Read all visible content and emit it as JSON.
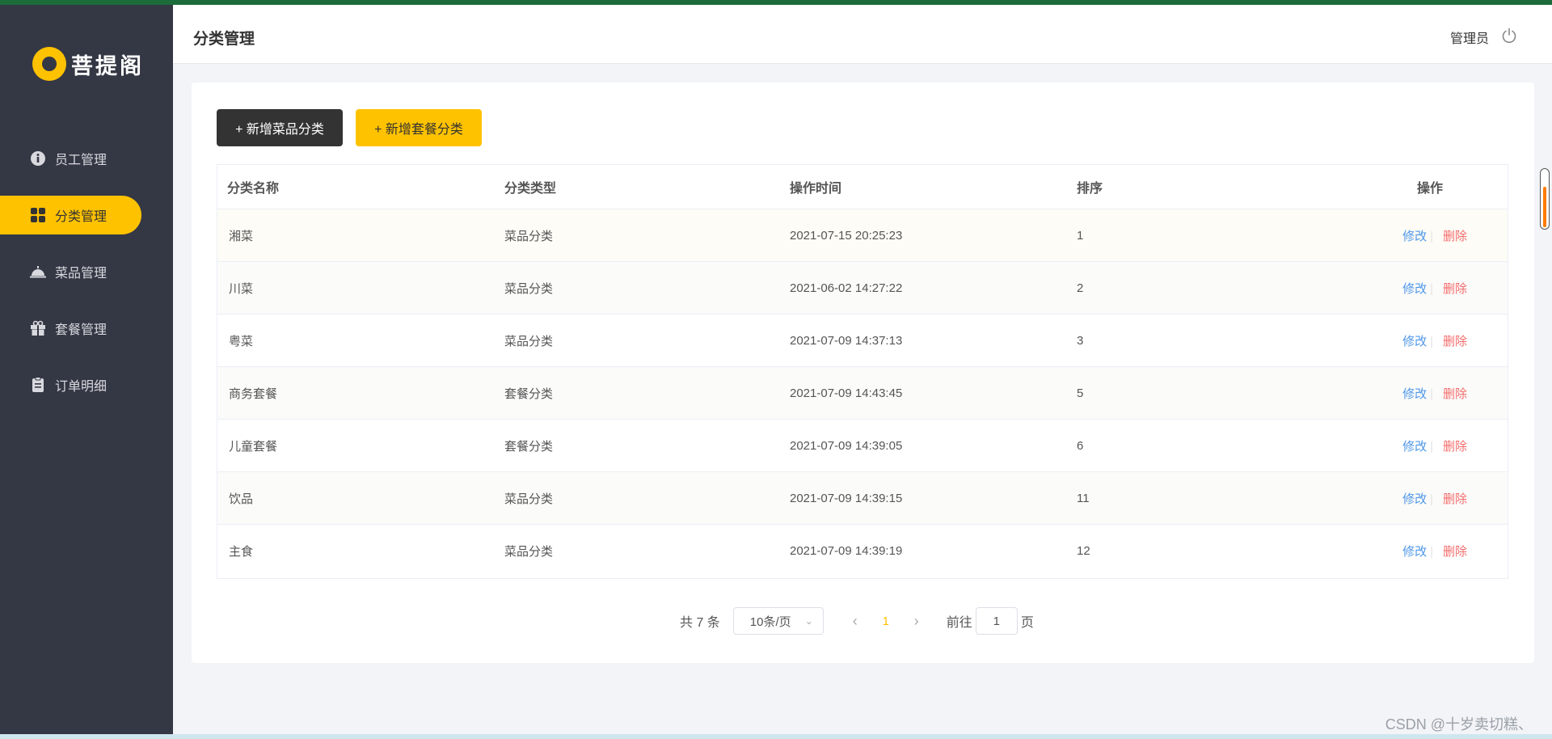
{
  "brand": {
    "name": "菩提阁",
    "accent": "#ffc200",
    "sidebar_bg": "#343744"
  },
  "sidebar": {
    "items": [
      {
        "label": "员工管理",
        "icon": "info-icon",
        "active": false
      },
      {
        "label": "分类管理",
        "icon": "grid-icon",
        "active": true
      },
      {
        "label": "菜品管理",
        "icon": "dish-cover-icon",
        "active": false
      },
      {
        "label": "套餐管理",
        "icon": "gift-icon",
        "active": false
      },
      {
        "label": "订单明细",
        "icon": "clipboard-icon",
        "active": false
      }
    ]
  },
  "header": {
    "title": "分类管理",
    "user": "管理员",
    "logout_icon": "power-icon"
  },
  "toolbar": {
    "add_dish_category": "+ 新增菜品分类",
    "add_setmeal_category": "+ 新增套餐分类"
  },
  "table": {
    "columns": [
      "分类名称",
      "分类类型",
      "操作时间",
      "排序",
      "操作"
    ],
    "rows": [
      {
        "name": "湘菜",
        "type": "菜品分类",
        "time": "2021-07-15 20:25:23",
        "sort": "1"
      },
      {
        "name": "川菜",
        "type": "菜品分类",
        "time": "2021-06-02 14:27:22",
        "sort": "2"
      },
      {
        "name": "粤菜",
        "type": "菜品分类",
        "time": "2021-07-09 14:37:13",
        "sort": "3"
      },
      {
        "name": "商务套餐",
        "type": "套餐分类",
        "time": "2021-07-09 14:43:45",
        "sort": "5"
      },
      {
        "name": "儿童套餐",
        "type": "套餐分类",
        "time": "2021-07-09 14:39:05",
        "sort": "6"
      },
      {
        "name": "饮品",
        "type": "菜品分类",
        "time": "2021-07-09 14:39:15",
        "sort": "11"
      },
      {
        "name": "主食",
        "type": "菜品分类",
        "time": "2021-07-09 14:39:19",
        "sort": "12"
      }
    ],
    "edit_label": "修改",
    "delete_label": "删除"
  },
  "pagination": {
    "total_text": "共 7 条",
    "page_size": "10条/页",
    "current_page": "1",
    "goto_prefix": "前往",
    "goto_value": "1",
    "goto_suffix": "页"
  },
  "watermark": "CSDN @十岁卖切糕、"
}
